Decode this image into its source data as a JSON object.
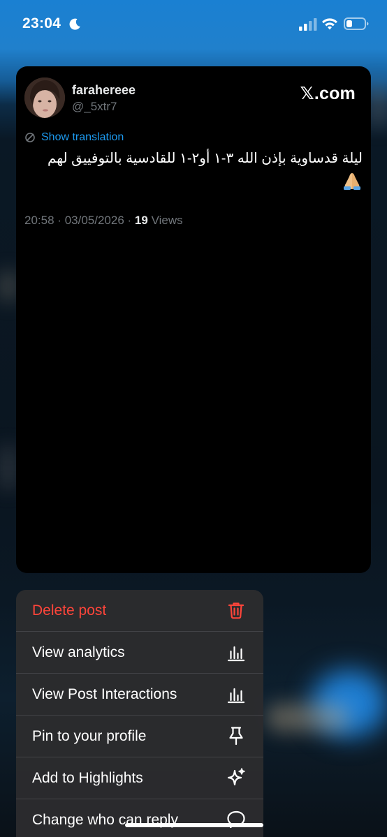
{
  "status_bar": {
    "time": "23:04",
    "icons": [
      "moon-icon",
      "signal-icon",
      "wifi-icon",
      "battery-icon"
    ]
  },
  "post": {
    "display_name": "farahereee",
    "handle": "@_5xtr7",
    "brand": "𝕏.com",
    "show_translation": "Show translation",
    "text": "ليلة قدساوية بإذن الله ٣-١ أو٢-١ للقادسية بالتوفييق لهم",
    "emoji": "pray-emoji",
    "time": "20:58",
    "date": "03/05/2026",
    "views_count": "19",
    "views_label": "Views",
    "separator": "·"
  },
  "menu": {
    "items": [
      {
        "label": "Delete post",
        "icon": "trash-icon",
        "color": "#ff453a"
      },
      {
        "label": "View analytics",
        "icon": "analytics-icon"
      },
      {
        "label": "View Post Interactions",
        "icon": "interactions-icon"
      },
      {
        "label": "Pin to your profile",
        "icon": "pin-icon"
      },
      {
        "label": "Add to Highlights",
        "icon": "sparkle-icon"
      },
      {
        "label": "Change who can reply",
        "icon": "reply-bubble-icon"
      }
    ]
  },
  "colors": {
    "accent": "#1d9bf0",
    "danger": "#ff453a",
    "card": "#000000",
    "menu": "#2c2c2e"
  }
}
